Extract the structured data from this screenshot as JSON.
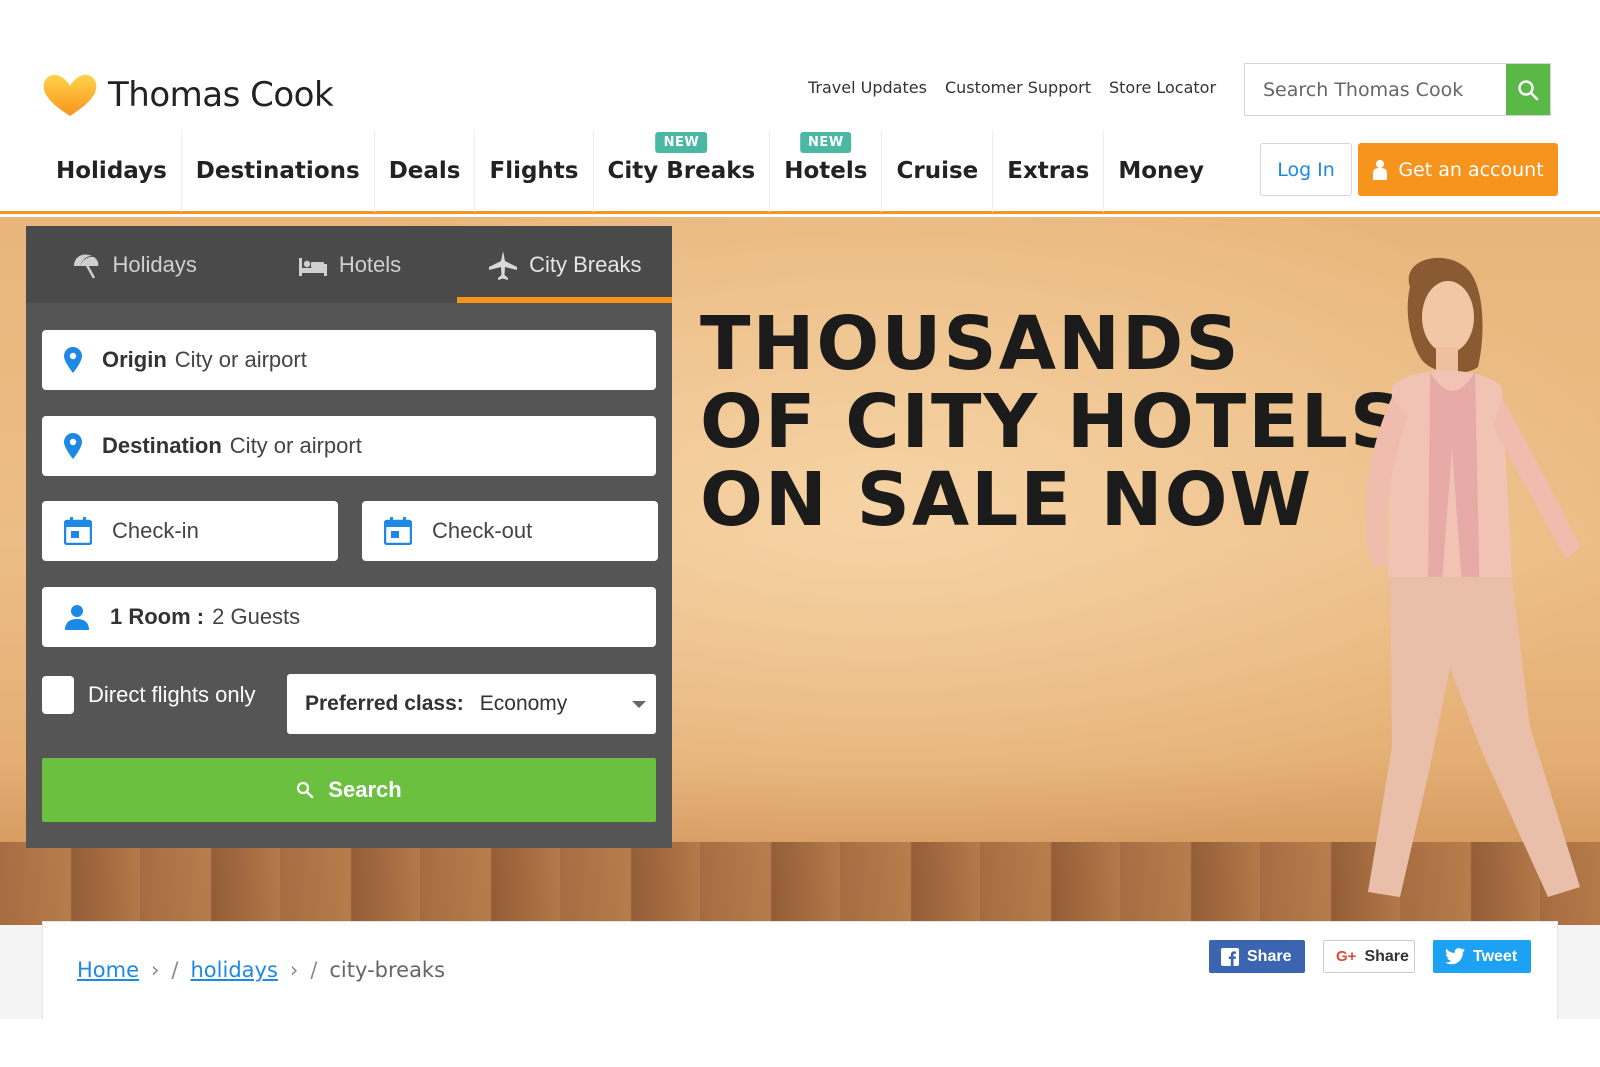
{
  "brand": {
    "name": "Thomas Cook",
    "accent": "#f7941d",
    "green": "#6cc03f"
  },
  "header": {
    "utility_links": [
      "Travel Updates",
      "Customer Support",
      "Store Locator"
    ],
    "search_placeholder": "Search Thomas Cook",
    "nav": [
      {
        "label": "Holidays",
        "badge": ""
      },
      {
        "label": "Destinations",
        "badge": ""
      },
      {
        "label": "Deals",
        "badge": ""
      },
      {
        "label": "Flights",
        "badge": ""
      },
      {
        "label": "City Breaks",
        "badge": "NEW"
      },
      {
        "label": "Hotels",
        "badge": "NEW"
      },
      {
        "label": "Cruise",
        "badge": ""
      },
      {
        "label": "Extras",
        "badge": ""
      },
      {
        "label": "Money",
        "badge": ""
      }
    ],
    "login_label": "Log In",
    "account_label": "Get an account"
  },
  "widget": {
    "tabs": [
      {
        "label": "Holidays",
        "icon": "umbrella-icon"
      },
      {
        "label": "Hotels",
        "icon": "bed-icon"
      },
      {
        "label": "City Breaks",
        "icon": "plane-icon"
      }
    ],
    "active_tab": "City Breaks",
    "origin": {
      "label": "Origin",
      "placeholder": "City or airport"
    },
    "destination": {
      "label": "Destination",
      "placeholder": "City or airport"
    },
    "checkin": "Check-in",
    "checkout": "Check-out",
    "guests": {
      "rooms": "1 Room :",
      "guests": "2 Guests"
    },
    "direct_flights_label": "Direct flights only",
    "preferred_class": {
      "label": "Preferred class:",
      "value": "Economy"
    },
    "search_label": "Search"
  },
  "hero": {
    "headline": [
      "THOUSANDS",
      "OF CITY HOTELS",
      "ON SALE NOW"
    ]
  },
  "breadcrumb": {
    "items": [
      "Home",
      "holidays"
    ],
    "current": "city-breaks"
  },
  "social": {
    "facebook": "Share",
    "google": "Share",
    "twitter": "Tweet"
  }
}
